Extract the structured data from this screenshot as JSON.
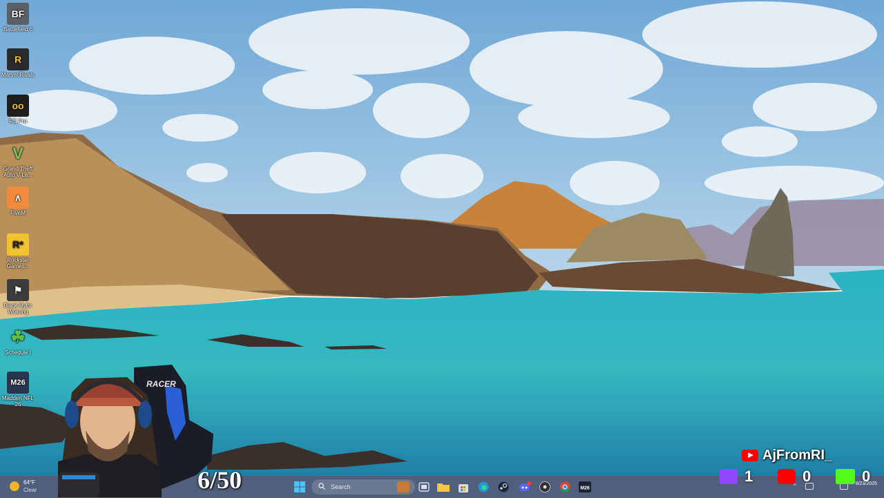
{
  "desktop": {
    "icons": [
      {
        "label": "Battlefield 6",
        "glyph": "BF"
      },
      {
        "label": "Marvel Rivals",
        "glyph": "R"
      },
      {
        "label": "RE Pro",
        "glyph": "oo"
      },
      {
        "label": "Grand Theft Auto V Le...",
        "glyph": "V"
      },
      {
        "label": "FiveM",
        "glyph": "∧"
      },
      {
        "label": "Rockstar Games...",
        "glyph": "R*"
      },
      {
        "label": "Black Myth: Wukong",
        "glyph": "⚑"
      },
      {
        "label": "Schedule I",
        "glyph": "☘"
      },
      {
        "label": "Madden NFL 26",
        "glyph": "M26"
      }
    ]
  },
  "taskbar": {
    "weather": {
      "temp": "64°F",
      "condition": "Clear"
    },
    "search_placeholder": "Search",
    "pinned_apps": [
      "windows-start",
      "search",
      "widgets",
      "task-view",
      "file-explorer",
      "store",
      "edge",
      "steam",
      "discord",
      "obs",
      "chrome",
      "madden-26"
    ],
    "clock": {
      "time": "",
      "date": "8/23/2025"
    }
  },
  "overlay": {
    "counter": "6/50",
    "channel_name": "AjFromRI_",
    "twitch_count": "1",
    "youtube_count": "0",
    "kick_count": "0",
    "webcam_chair_brand": "RACER"
  },
  "colors": {
    "taskbar": "#283c5f",
    "youtube": "#ff0000",
    "twitch": "#9146ff",
    "kick": "#53fc18"
  }
}
